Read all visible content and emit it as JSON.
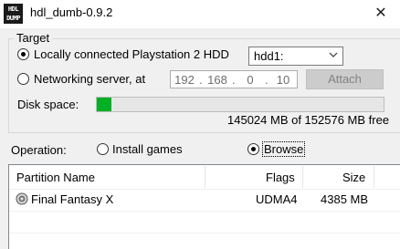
{
  "window": {
    "app_icon_text": "HDL DUMP",
    "title": "hdl_dumb-0.9.2",
    "close_glyph": "✕"
  },
  "target": {
    "group_label": "Target",
    "local_label": "Locally connected Playstation 2 HDD",
    "local_checked": true,
    "hdd_select_value": "hdd1:",
    "network_label": "Networking server, at",
    "network_checked": false,
    "ip": [
      "192",
      "168",
      "0",
      "10"
    ],
    "attach_label": "Attach",
    "attach_enabled": false,
    "disk_space_label": "Disk space:",
    "disk_usage_fraction": 0.05,
    "disk_free_text": "145024 MB of 152576 MB free"
  },
  "operation": {
    "label": "Operation:",
    "install_label": "Install games",
    "install_checked": false,
    "browse_label": "Browse",
    "browse_checked": true
  },
  "table": {
    "headers": {
      "name": "Partition Name",
      "flags": "Flags",
      "size": "Size"
    },
    "rows": [
      {
        "name": "Final Fantasy X",
        "flags": "UDMA4",
        "size": "4385 MB",
        "icon": "disc-icon"
      }
    ]
  },
  "colors": {
    "progress": "#06b025",
    "window_bg": "#f0f0f0"
  }
}
